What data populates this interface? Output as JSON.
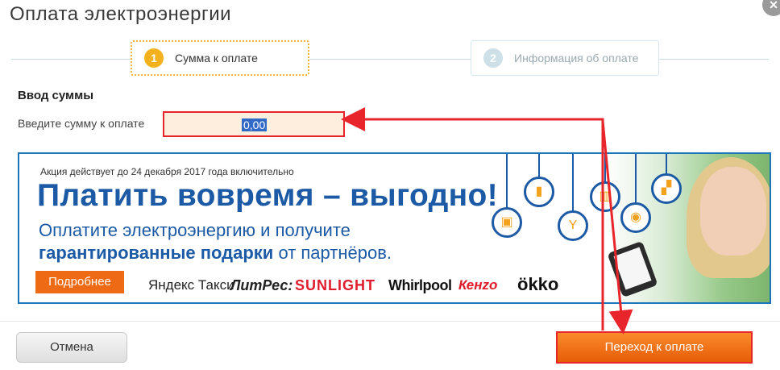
{
  "dialog": {
    "title": "Оплата электроэнергии",
    "close_symbol": "×"
  },
  "steps": [
    {
      "number": "1",
      "label": "Сумма к оплате",
      "active": true
    },
    {
      "number": "2",
      "label": "Информация об оплате",
      "active": false
    }
  ],
  "form": {
    "section_title": "Ввод суммы",
    "amount_label": "Введите сумму к оплате",
    "amount_value": "0,00"
  },
  "banner": {
    "promo_note": "Акция действует до 24 декабря 2017 года включительно",
    "headline": "Платить вовремя – выгодно!",
    "subline1": "Оплатите электроэнергию и получите",
    "subline2_bold": "гарантированные подарки",
    "subline2_rest": " от партнёров.",
    "more_button": "Подробнее",
    "partners": [
      "Яндекс Такси",
      "ЛитРес:",
      "SUNLIGHT",
      "Whirlpool",
      "Кенzo",
      "ökko"
    ]
  },
  "footer": {
    "cancel_label": "Отмена",
    "submit_label": "Переход к оплате"
  },
  "colors": {
    "accent_orange": "#ef6a14",
    "highlight_red": "#e8252a",
    "brand_blue": "#1c5aa6",
    "step_active": "#f3b21d"
  }
}
